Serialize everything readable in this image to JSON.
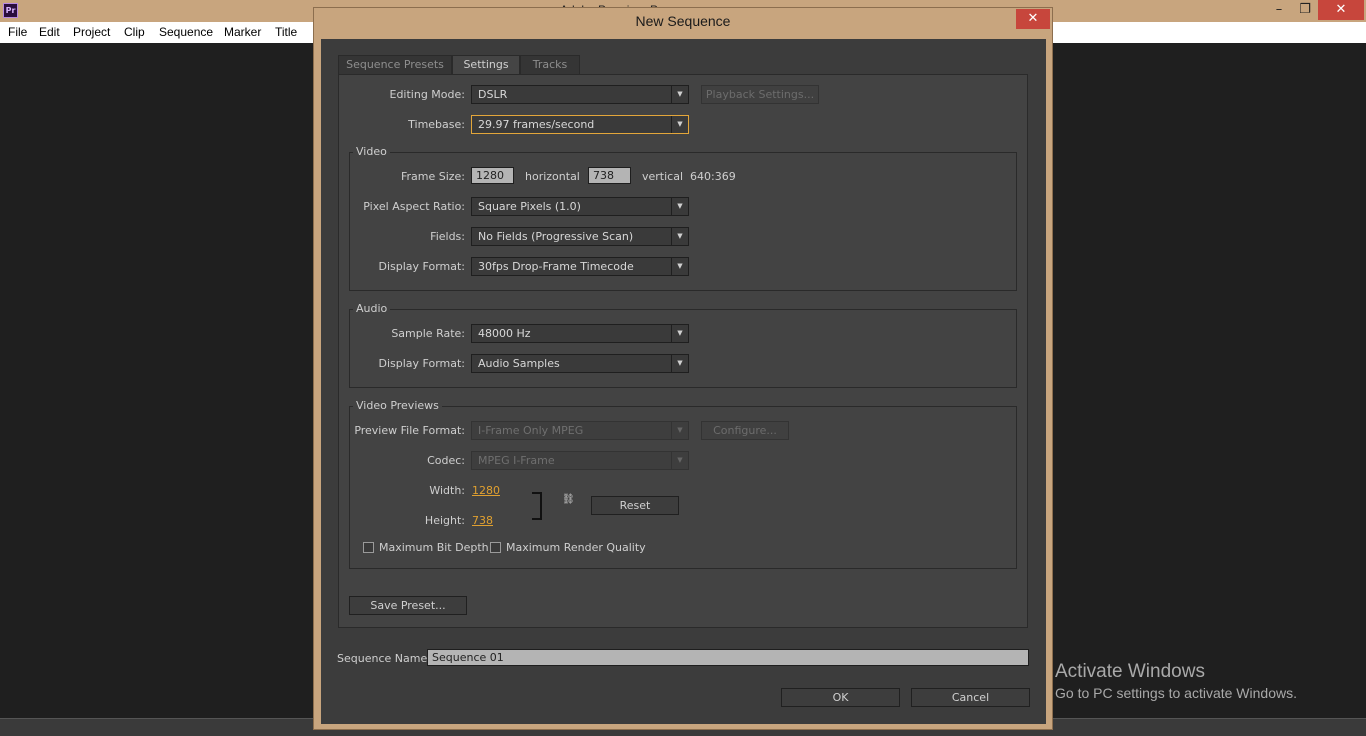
{
  "app": {
    "logo": "Pr",
    "title": "Adobe Premiere Pro",
    "controls": {
      "minimize": "–",
      "maximize": "❐",
      "close": "✕"
    },
    "menu": [
      "File",
      "Edit",
      "Project",
      "Clip",
      "Sequence",
      "Marker",
      "Title"
    ]
  },
  "dialog": {
    "title": "New Sequence",
    "close": "✕",
    "tabs": [
      {
        "label": "Sequence Presets",
        "active": false
      },
      {
        "label": "Settings",
        "active": true
      },
      {
        "label": "Tracks",
        "active": false
      }
    ],
    "editing_mode": {
      "label": "Editing Mode:",
      "value": "DSLR"
    },
    "playback_settings": "Playback Settings...",
    "timebase": {
      "label": "Timebase:",
      "value": "29.97 frames/second"
    },
    "video": {
      "title": "Video",
      "frame_size": {
        "label": "Frame Size:",
        "horizontal": "1280",
        "horizontal_label": "horizontal",
        "vertical": "738",
        "vertical_label": "vertical",
        "ratio": "640:369"
      },
      "pixel_aspect_ratio": {
        "label": "Pixel Aspect Ratio:",
        "value": "Square Pixels (1.0)"
      },
      "fields": {
        "label": "Fields:",
        "value": "No Fields (Progressive Scan)"
      },
      "display_format": {
        "label": "Display Format:",
        "value": "30fps Drop-Frame Timecode"
      }
    },
    "audio": {
      "title": "Audio",
      "sample_rate": {
        "label": "Sample Rate:",
        "value": "48000 Hz"
      },
      "display_format": {
        "label": "Display Format:",
        "value": "Audio Samples"
      }
    },
    "video_previews": {
      "title": "Video Previews",
      "preview_file_format": {
        "label": "Preview File Format:",
        "value": "I-Frame Only MPEG"
      },
      "configure": "Configure...",
      "codec": {
        "label": "Codec:",
        "value": "MPEG I-Frame"
      },
      "width": {
        "label": "Width:",
        "value": "1280"
      },
      "height": {
        "label": "Height:",
        "value": "738"
      },
      "reset": "Reset",
      "max_bit_depth": "Maximum Bit Depth",
      "max_render_quality": "Maximum Render Quality"
    },
    "save_preset": "Save Preset...",
    "sequence_name": {
      "label": "Sequence Name:",
      "value": "Sequence 01"
    },
    "ok": "OK",
    "cancel": "Cancel"
  },
  "watermark": {
    "line1": "Activate Windows",
    "line2": "Go to PC settings to activate Windows."
  }
}
